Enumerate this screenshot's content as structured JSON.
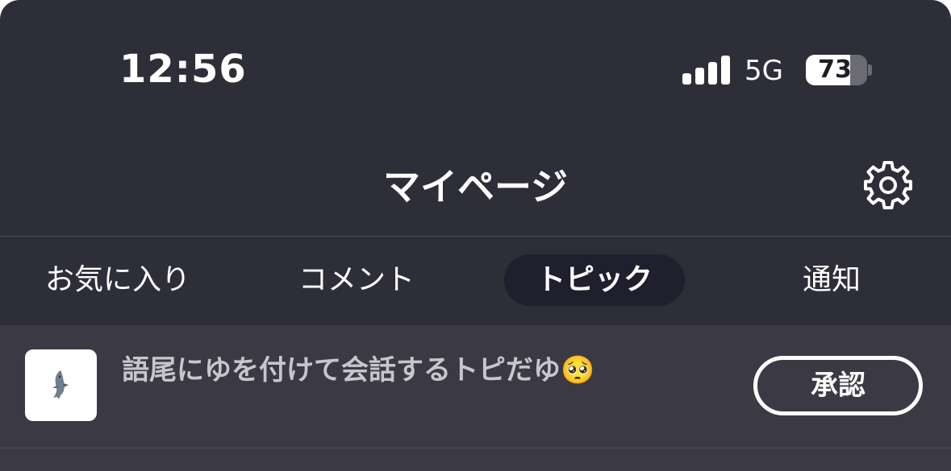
{
  "status_bar": {
    "time": "12:56",
    "network": "5G",
    "battery": "73",
    "battery_level": 0.73
  },
  "header": {
    "title": "マイページ",
    "settings_icon": "gear-icon"
  },
  "tabs": [
    {
      "label": "お気に入り",
      "active": false
    },
    {
      "label": "コメント",
      "active": false
    },
    {
      "label": "トピック",
      "active": true
    },
    {
      "label": "通知",
      "active": false
    }
  ],
  "topics": [
    {
      "title": "語尾にゆを付けて会話するトピだゆ🥺",
      "thumbnail_icon": "dolphin-icon",
      "action_label": "承認"
    }
  ],
  "colors": {
    "background": "#2e2e38",
    "active_tab": "#1f1f2e",
    "list_background": "#3b3a44",
    "topic_text": "#c6c6cc"
  }
}
